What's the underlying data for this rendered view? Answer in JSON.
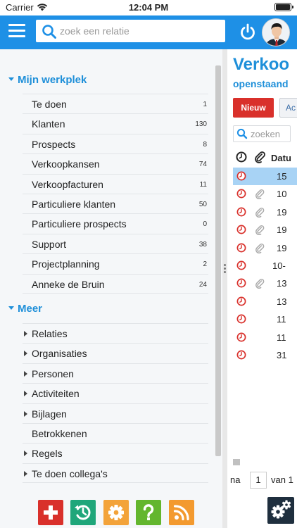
{
  "status": {
    "carrier": "Carrier",
    "time": "12:04 PM"
  },
  "header": {
    "search_placeholder": "zoek een relatie"
  },
  "workplace": {
    "title": "Mijn werkplek",
    "items": [
      {
        "label": "Te doen",
        "count": "1"
      },
      {
        "label": "Klanten",
        "count": "130"
      },
      {
        "label": "Prospects",
        "count": "8"
      },
      {
        "label": "Verkoopkansen",
        "count": "74"
      },
      {
        "label": "Verkoopfacturen",
        "count": "11"
      },
      {
        "label": "Particuliere klanten",
        "count": "50"
      },
      {
        "label": "Particuliere prospects",
        "count": "0"
      },
      {
        "label": "Support",
        "count": "38"
      },
      {
        "label": "Projectplanning",
        "count": "2"
      },
      {
        "label": "Anneke de Bruin",
        "count": "24"
      }
    ]
  },
  "more": {
    "title": "Meer",
    "items": [
      {
        "label": "Relaties"
      },
      {
        "label": "Organisaties"
      },
      {
        "label": "Personen"
      },
      {
        "label": "Activiteiten"
      },
      {
        "label": "Bijlagen"
      },
      {
        "label": "Betrokkenen"
      },
      {
        "label": "Regels"
      },
      {
        "label": "Te doen collega's"
      }
    ]
  },
  "right": {
    "title": "Verkoo",
    "subtitle": "openstaand",
    "new_button": "Nieuw",
    "action_button": "Ac",
    "search_placeholder": "zoeken",
    "date_header": "Datu",
    "rows": [
      {
        "date": "15"
      },
      {
        "date": "10"
      },
      {
        "date": "19"
      },
      {
        "date": "19"
      },
      {
        "date": "19"
      },
      {
        "date": "10-"
      },
      {
        "date": "13"
      },
      {
        "date": "13"
      },
      {
        "date": "11"
      },
      {
        "date": "11"
      },
      {
        "date": "31"
      }
    ],
    "pager": {
      "before": "na",
      "page": "1",
      "after": "van 1"
    }
  },
  "colors": {
    "header_blue": "#1e90e6",
    "accent_blue": "#1e8fd9",
    "new_red": "#d9302b",
    "selected_row": "#a8d3f5"
  },
  "icons": {
    "toolbar": [
      "plus-icon",
      "history-icon",
      "gear-icon",
      "help-icon",
      "rss-icon"
    ],
    "settings": "gears-icon"
  }
}
